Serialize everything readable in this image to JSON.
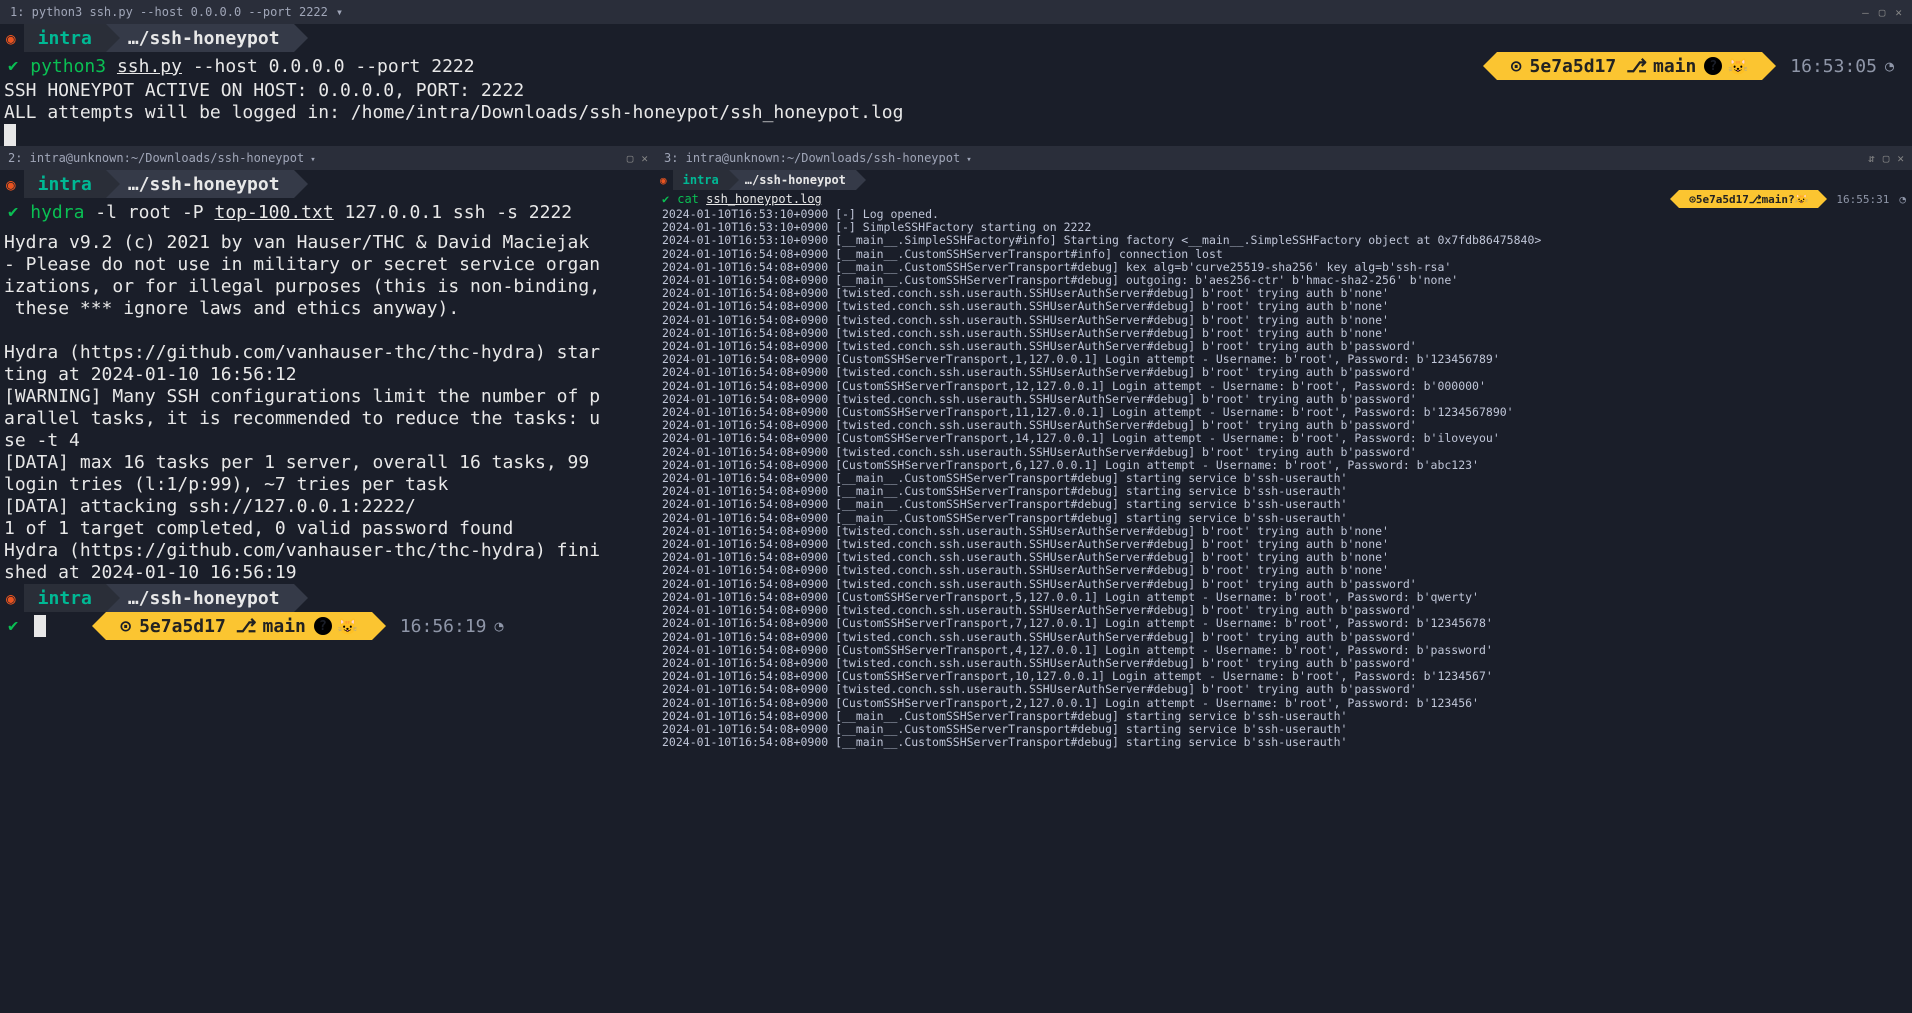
{
  "top_pane": {
    "title": "1: python3 ssh.py --host 0.0.0.0 --port 2222",
    "user": "intra",
    "path": "…/ssh-honeypot",
    "cmd_prog": "python3",
    "cmd_file": "ssh.py",
    "cmd_rest": " --host 0.0.0.0 --port 2222",
    "out": "SSH HONEYPOT ACTIVE ON HOST: 0.0.0.0, PORT: 2222\nALL attempts will be logged in: /home/intra/Downloads/ssh-honeypot/ssh_honeypot.log",
    "git_hash": "5e7a5d17",
    "branch": "main",
    "time": "16:53:05"
  },
  "left_pane": {
    "title": "2: intra@unknown:~/Downloads/ssh-honeypot",
    "user": "intra",
    "path": "…/ssh-honeypot",
    "cmd_prog": "hydra",
    "cmd_rest1": " -l root -P ",
    "cmd_file": "top-100.txt",
    "cmd_rest2": " 127.0.0.1 ssh -s 2222",
    "body": "Hydra v9.2 (c) 2021 by van Hauser/THC & David Maciejak\n- Please do not use in military or secret service organ\nizations, or for illegal purposes (this is non-binding,\n these *** ignore laws and ethics anyway).\n\nHydra (https://github.com/vanhauser-thc/thc-hydra) star\nting at 2024-01-10 16:56:12\n[WARNING] Many SSH configurations limit the number of p\narallel tasks, it is recommended to reduce the tasks: u\nse -t 4\n[DATA] max 16 tasks per 1 server, overall 16 tasks, 99\nlogin tries (l:1/p:99), ~7 tries per task\n[DATA] attacking ssh://127.0.0.1:2222/\n1 of 1 target completed, 0 valid password found\nHydra (https://github.com/vanhauser-thc/thc-hydra) fini\nshed at 2024-01-10 16:56:19",
    "git_hash": "5e7a5d17",
    "branch": "main",
    "time": "16:56:19"
  },
  "right_pane": {
    "title": "3: intra@unknown:~/Downloads/ssh-honeypot",
    "user": "intra",
    "path": "…/ssh-honeypot",
    "cmd_prog": "cat",
    "cmd_file": "ssh_honeypot.log",
    "git_hash": "5e7a5d17",
    "branch": "main",
    "time": "16:55:31",
    "log": "2024-01-10T16:53:10+0900 [-] Log opened.\n2024-01-10T16:53:10+0900 [-] SimpleSSHFactory starting on 2222\n2024-01-10T16:53:10+0900 [__main__.SimpleSSHFactory#info] Starting factory <__main__.SimpleSSHFactory object at 0x7fdb86475840>\n2024-01-10T16:54:08+0900 [__main__.CustomSSHServerTransport#info] connection lost\n2024-01-10T16:54:08+0900 [__main__.CustomSSHServerTransport#debug] kex alg=b'curve25519-sha256' key alg=b'ssh-rsa'\n2024-01-10T16:54:08+0900 [__main__.CustomSSHServerTransport#debug] outgoing: b'aes256-ctr' b'hmac-sha2-256' b'none'\n2024-01-10T16:54:08+0900 [twisted.conch.ssh.userauth.SSHUserAuthServer#debug] b'root' trying auth b'none'\n2024-01-10T16:54:08+0900 [twisted.conch.ssh.userauth.SSHUserAuthServer#debug] b'root' trying auth b'none'\n2024-01-10T16:54:08+0900 [twisted.conch.ssh.userauth.SSHUserAuthServer#debug] b'root' trying auth b'none'\n2024-01-10T16:54:08+0900 [twisted.conch.ssh.userauth.SSHUserAuthServer#debug] b'root' trying auth b'none'\n2024-01-10T16:54:08+0900 [twisted.conch.ssh.userauth.SSHUserAuthServer#debug] b'root' trying auth b'password'\n2024-01-10T16:54:08+0900 [CustomSSHServerTransport,1,127.0.0.1] Login attempt - Username: b'root', Password: b'123456789'\n2024-01-10T16:54:08+0900 [twisted.conch.ssh.userauth.SSHUserAuthServer#debug] b'root' trying auth b'password'\n2024-01-10T16:54:08+0900 [CustomSSHServerTransport,12,127.0.0.1] Login attempt - Username: b'root', Password: b'000000'\n2024-01-10T16:54:08+0900 [twisted.conch.ssh.userauth.SSHUserAuthServer#debug] b'root' trying auth b'password'\n2024-01-10T16:54:08+0900 [CustomSSHServerTransport,11,127.0.0.1] Login attempt - Username: b'root', Password: b'1234567890'\n2024-01-10T16:54:08+0900 [twisted.conch.ssh.userauth.SSHUserAuthServer#debug] b'root' trying auth b'password'\n2024-01-10T16:54:08+0900 [CustomSSHServerTransport,14,127.0.0.1] Login attempt - Username: b'root', Password: b'iloveyou'\n2024-01-10T16:54:08+0900 [twisted.conch.ssh.userauth.SSHUserAuthServer#debug] b'root' trying auth b'password'\n2024-01-10T16:54:08+0900 [CustomSSHServerTransport,6,127.0.0.1] Login attempt - Username: b'root', Password: b'abc123'\n2024-01-10T16:54:08+0900 [__main__.CustomSSHServerTransport#debug] starting service b'ssh-userauth'\n2024-01-10T16:54:08+0900 [__main__.CustomSSHServerTransport#debug] starting service b'ssh-userauth'\n2024-01-10T16:54:08+0900 [__main__.CustomSSHServerTransport#debug] starting service b'ssh-userauth'\n2024-01-10T16:54:08+0900 [__main__.CustomSSHServerTransport#debug] starting service b'ssh-userauth'\n2024-01-10T16:54:08+0900 [twisted.conch.ssh.userauth.SSHUserAuthServer#debug] b'root' trying auth b'none'\n2024-01-10T16:54:08+0900 [twisted.conch.ssh.userauth.SSHUserAuthServer#debug] b'root' trying auth b'none'\n2024-01-10T16:54:08+0900 [twisted.conch.ssh.userauth.SSHUserAuthServer#debug] b'root' trying auth b'none'\n2024-01-10T16:54:08+0900 [twisted.conch.ssh.userauth.SSHUserAuthServer#debug] b'root' trying auth b'none'\n2024-01-10T16:54:08+0900 [twisted.conch.ssh.userauth.SSHUserAuthServer#debug] b'root' trying auth b'password'\n2024-01-10T16:54:08+0900 [CustomSSHServerTransport,5,127.0.0.1] Login attempt - Username: b'root', Password: b'qwerty'\n2024-01-10T16:54:08+0900 [twisted.conch.ssh.userauth.SSHUserAuthServer#debug] b'root' trying auth b'password'\n2024-01-10T16:54:08+0900 [CustomSSHServerTransport,7,127.0.0.1] Login attempt - Username: b'root', Password: b'12345678'\n2024-01-10T16:54:08+0900 [twisted.conch.ssh.userauth.SSHUserAuthServer#debug] b'root' trying auth b'password'\n2024-01-10T16:54:08+0900 [CustomSSHServerTransport,4,127.0.0.1] Login attempt - Username: b'root', Password: b'password'\n2024-01-10T16:54:08+0900 [twisted.conch.ssh.userauth.SSHUserAuthServer#debug] b'root' trying auth b'password'\n2024-01-10T16:54:08+0900 [CustomSSHServerTransport,10,127.0.0.1] Login attempt - Username: b'root', Password: b'1234567'\n2024-01-10T16:54:08+0900 [twisted.conch.ssh.userauth.SSHUserAuthServer#debug] b'root' trying auth b'password'\n2024-01-10T16:54:08+0900 [CustomSSHServerTransport,2,127.0.0.1] Login attempt - Username: b'root', Password: b'123456'\n2024-01-10T16:54:08+0900 [__main__.CustomSSHServerTransport#debug] starting service b'ssh-userauth'\n2024-01-10T16:54:08+0900 [__main__.CustomSSHServerTransport#debug] starting service b'ssh-userauth'\n2024-01-10T16:54:08+0900 [__main__.CustomSSHServerTransport#debug] starting service b'ssh-userauth'"
  }
}
